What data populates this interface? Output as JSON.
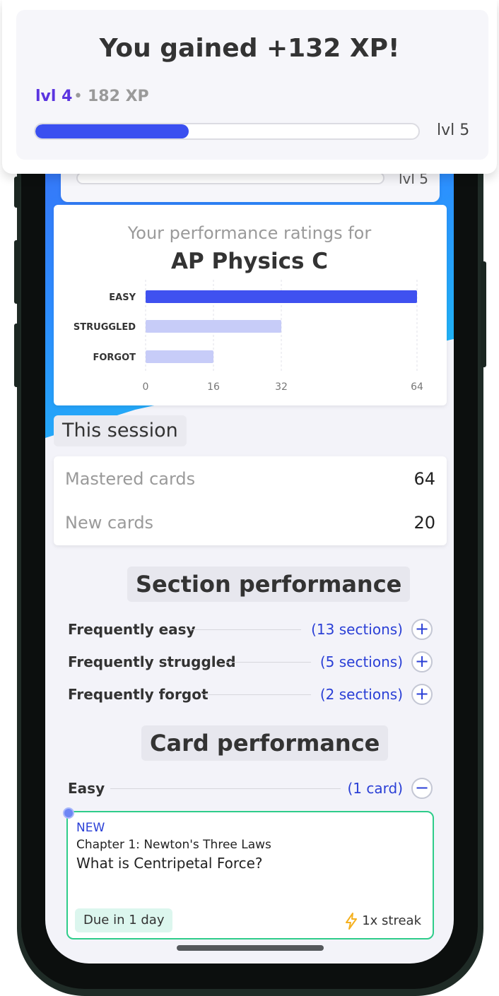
{
  "xp_popup": {
    "title": "You gained +132 XP!",
    "current_level": "lvl 4",
    "separator": "•",
    "total_xp": "182 XP",
    "progress_fraction": 0.4,
    "next_level": "lvl 5"
  },
  "level_card": {
    "next_level": "lvl 5"
  },
  "ratings": {
    "subtitle": "Your performance ratings for",
    "course": "AP Physics C"
  },
  "chart_data": {
    "type": "bar",
    "orientation": "horizontal",
    "categories": [
      "EASY",
      "STRUGGLED",
      "FORGOT"
    ],
    "values": [
      64,
      32,
      16
    ],
    "xticks": [
      0,
      16,
      32,
      64
    ],
    "xlim": [
      0,
      64
    ],
    "colors": [
      "#3f51f0",
      "#c7ccf8",
      "#c7ccf8"
    ],
    "grid": true
  },
  "session": {
    "heading": "This session",
    "stats": [
      {
        "label": "Mastered cards",
        "value": "64"
      },
      {
        "label": "New cards",
        "value": "20"
      }
    ]
  },
  "section_performance": {
    "heading": "Section performance",
    "rows": [
      {
        "label": "Frequently easy",
        "count": "(13 sections)",
        "toggle": "+"
      },
      {
        "label": "Frequently struggled",
        "count": "(5 sections)",
        "toggle": "+"
      },
      {
        "label": "Frequently forgot",
        "count": "(2 sections)",
        "toggle": "+"
      }
    ]
  },
  "card_performance": {
    "heading": "Card performance",
    "group": {
      "label": "Easy",
      "count": "(1 card)",
      "toggle": "−"
    },
    "card": {
      "tag": "NEW",
      "chapter": "Chapter 1: Newton's Three Laws",
      "question": "What is Centripetal Force?",
      "due": "Due in 1 day",
      "streak": "1x streak",
      "streak_icon": "lightning-icon"
    }
  },
  "colors": {
    "accent": "#3a4ff0",
    "level_purple": "#5b35e0",
    "link_blue": "#2a3fd6",
    "card_border": "#2ecc8a",
    "due_badge_bg": "#dcf6ee"
  }
}
